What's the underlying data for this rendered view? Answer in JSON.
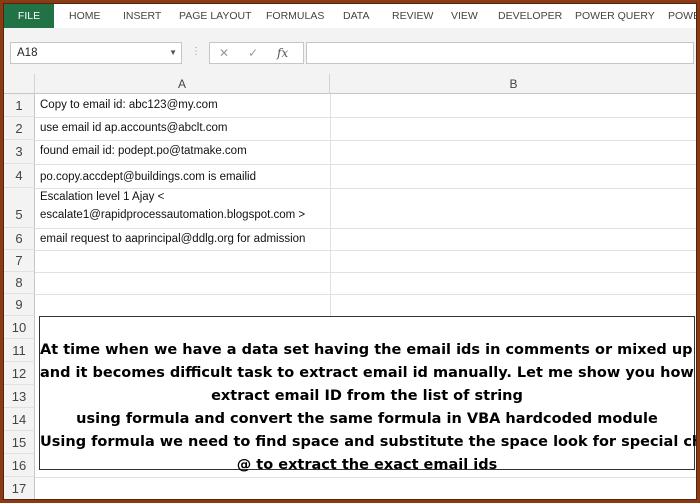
{
  "ribbon": {
    "tabs": [
      "FILE",
      "HOME",
      "INSERT",
      "PAGE LAYOUT",
      "FORMULAS",
      "DATA",
      "REVIEW",
      "VIEW",
      "DEVELOPER",
      "POWER QUERY",
      "POWERPIVOT"
    ]
  },
  "formula_bar": {
    "name_box": "A18",
    "cancel_icon": "✕",
    "enter_icon": "✓",
    "fx_label": "fx",
    "formula_value": ""
  },
  "columns": [
    "A",
    "B"
  ],
  "rows": [
    "1",
    "2",
    "3",
    "4",
    "5",
    "6",
    "7",
    "8",
    "9",
    "10",
    "11",
    "12",
    "13",
    "14",
    "15",
    "16",
    "17"
  ],
  "cells": {
    "A1": "Copy to email id: abc123@my.com",
    "A2": "use email id ap.accounts@abclt.com",
    "A3": "found email id: podept.po@tatmake.com",
    "A4": "po.copy.accdept@buildings.com is emailid",
    "A5_line1": "Escalation level 1 Ajay  <",
    "A5_line2": "escalate1@rapidprocessautomation.blogspot.com >",
    "A6": "email request to aaprincipal@ddlg.org for admission"
  },
  "textbox": {
    "lines": [
      "At time when we have a data set having the email ids in comments or mixed up in string",
      "and it becomes difficult task to extract email id manually. Let me show you how to",
      "extract email ID from the list of string",
      "using formula and convert the same formula in VBA hardcoded module",
      "Using formula we need to find space and substitute the space look for special character",
      "@ to extract the exact email ids"
    ]
  },
  "colors": {
    "file_tab": "#217346",
    "frame": "#8b3a16"
  }
}
